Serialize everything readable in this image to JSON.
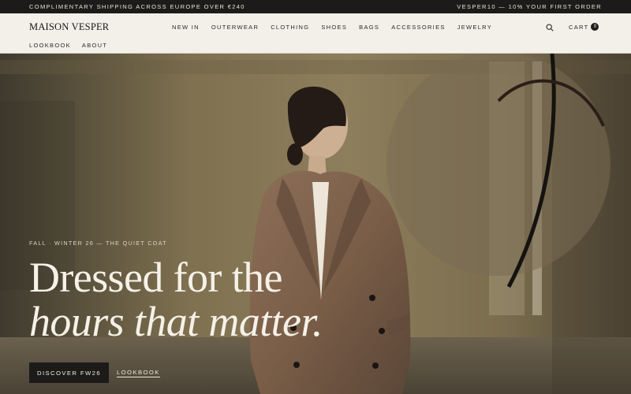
{
  "announcement": {
    "left": "COMPLIMENTARY SHIPPING ACROSS EUROPE OVER €240",
    "right": "VESPER10 — 10% YOUR FIRST ORDER"
  },
  "header": {
    "brand": "MAISON VESPER",
    "nav": [
      "NEW IN",
      "OUTERWEAR",
      "CLOTHING",
      "SHOES",
      "BAGS",
      "ACCESSORIES",
      "JEWELRY"
    ],
    "subnav": [
      "LOOKBOOK",
      "ABOUT"
    ],
    "cart_label": "CART",
    "cart_count": "0"
  },
  "hero": {
    "eyebrow": "FALL · WINTER 26 — THE QUIET COAT",
    "headline_line1": "Dressed for the",
    "headline_line2": "hours that matter.",
    "primary_cta": "DISCOVER FW26",
    "secondary_cta": "LOOKBOOK"
  },
  "colors": {
    "topbar": "#1c1b19",
    "header": "#f3f0e9",
    "accent": "#1c1b19"
  }
}
